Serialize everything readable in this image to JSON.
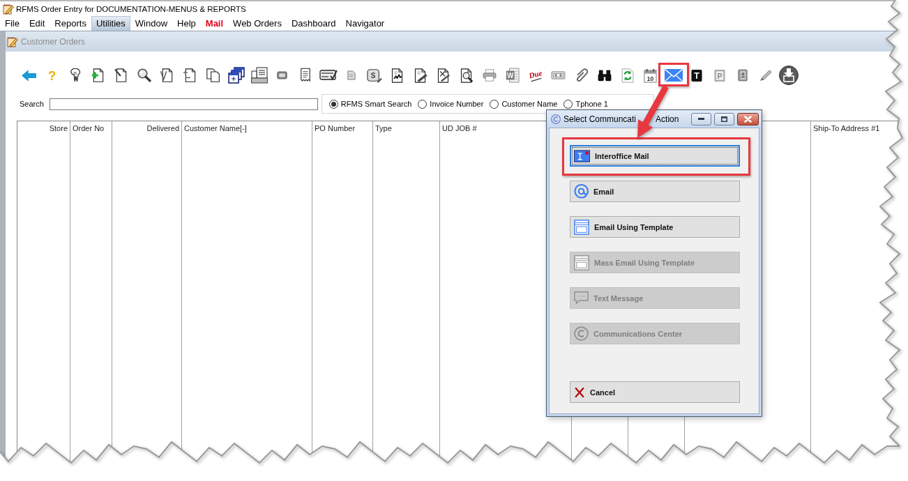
{
  "window": {
    "title": "RFMS Order Entry for DOCUMENTATION-MENUS & REPORTS"
  },
  "menu_bar": [
    {
      "label": "File",
      "selected": false,
      "emphasized": false
    },
    {
      "label": "Edit",
      "selected": false,
      "emphasized": false
    },
    {
      "label": "Reports",
      "selected": false,
      "emphasized": false
    },
    {
      "label": "Utilities",
      "selected": true,
      "emphasized": false
    },
    {
      "label": "Window",
      "selected": false,
      "emphasized": false
    },
    {
      "label": "Help",
      "selected": false,
      "emphasized": false
    },
    {
      "label": "Mail",
      "selected": false,
      "emphasized": true
    },
    {
      "label": "Web Orders",
      "selected": false,
      "emphasized": false
    },
    {
      "label": "Dashboard",
      "selected": false,
      "emphasized": false
    },
    {
      "label": "Navigator",
      "selected": false,
      "emphasized": false
    }
  ],
  "child_window": {
    "title": "Customer Orders"
  },
  "toolbar": [
    {
      "kind": "back",
      "highlighted": false
    },
    {
      "kind": "help",
      "text": "?",
      "highlighted": false
    },
    {
      "kind": "hand",
      "highlighted": false
    },
    {
      "kind": "add",
      "highlighted": false
    },
    {
      "kind": "edit",
      "highlighted": false
    },
    {
      "kind": "find",
      "highlighted": false
    },
    {
      "kind": "verify",
      "highlighted": false
    },
    {
      "kind": "adjust",
      "highlighted": false
    },
    {
      "kind": "copy",
      "highlighted": false
    },
    {
      "kind": "windows",
      "highlighted": false
    },
    {
      "kind": "tray",
      "highlighted": false
    },
    {
      "kind": "chip",
      "highlighted": false
    },
    {
      "kind": "receipt",
      "highlighted": false
    },
    {
      "kind": "card",
      "highlighted": false
    },
    {
      "kind": "note",
      "highlighted": false
    },
    {
      "kind": "cube",
      "text": "S",
      "highlighted": false
    },
    {
      "kind": "scribble",
      "highlighted": false
    },
    {
      "kind": "sign",
      "highlighted": false
    },
    {
      "kind": "unsign",
      "highlighted": false
    },
    {
      "kind": "inspect",
      "highlighted": false
    },
    {
      "kind": "print",
      "highlighted": false
    },
    {
      "kind": "word",
      "text": "W",
      "highlighted": false
    },
    {
      "kind": "due",
      "text": "Due",
      "highlighted": false
    },
    {
      "kind": "tape",
      "highlighted": false
    },
    {
      "kind": "clip",
      "highlighted": false
    },
    {
      "kind": "binoculars",
      "highlighted": false
    },
    {
      "kind": "refresh",
      "highlighted": false
    },
    {
      "kind": "calendar",
      "text": "10",
      "highlighted": false
    },
    {
      "kind": "mail",
      "highlighted": true
    },
    {
      "kind": "tile",
      "text": "T",
      "highlighted": false
    },
    {
      "kind": "plate",
      "text": "P",
      "highlighted": false
    },
    {
      "kind": "book",
      "highlighted": false
    },
    {
      "kind": "pen",
      "highlighted": false
    },
    {
      "kind": "download",
      "highlighted": false
    }
  ],
  "search": {
    "label": "Search"
  },
  "search_modes": [
    {
      "label": "RFMS Smart Search",
      "selected": true
    },
    {
      "label": "Invoice Number",
      "selected": false
    },
    {
      "label": "Customer Name",
      "selected": false
    },
    {
      "label": "Tphone 1",
      "selected": false
    }
  ],
  "table": {
    "columns": [
      {
        "kind": "heading",
        "label": "Store"
      },
      {
        "kind": "heading",
        "label": "Order No"
      },
      {
        "kind": "heading",
        "label": "Delivered"
      },
      {
        "kind": "heading",
        "label": "Customer Name[-]"
      },
      {
        "kind": "heading",
        "label": "PO Number"
      },
      {
        "kind": "heading",
        "label": "Type"
      },
      {
        "kind": "heading",
        "label": "UD JOB #"
      },
      {
        "kind": "blank"
      },
      {
        "kind": "blank"
      },
      {
        "kind": "blank"
      },
      {
        "kind": "heading",
        "label": "Ship-To Address #1"
      }
    ]
  },
  "dialog": {
    "title_parts": [
      "Select Communcati",
      "Action"
    ],
    "buttons": [
      {
        "kind": "interoffice",
        "label": "Interoffice Mail",
        "disabled": false,
        "focused": true,
        "highlighted": true
      },
      {
        "kind": "email",
        "label": "Email",
        "disabled": false,
        "focused": false,
        "highlighted": false
      },
      {
        "kind": "template",
        "label": "Email Using Template",
        "disabled": false,
        "focused": false,
        "highlighted": false
      },
      {
        "kind": "template",
        "label": "Mass Email Using Template",
        "disabled": true,
        "focused": false,
        "highlighted": false
      },
      {
        "kind": "sms",
        "label": "Text Message",
        "disabled": true,
        "focused": false,
        "highlighted": false
      },
      {
        "kind": "center",
        "label": "Communications Center",
        "disabled": true,
        "focused": false,
        "highlighted": false
      },
      {
        "kind": "cancel",
        "label": "Cancel",
        "disabled": false,
        "focused": false,
        "highlighted": false
      }
    ]
  }
}
